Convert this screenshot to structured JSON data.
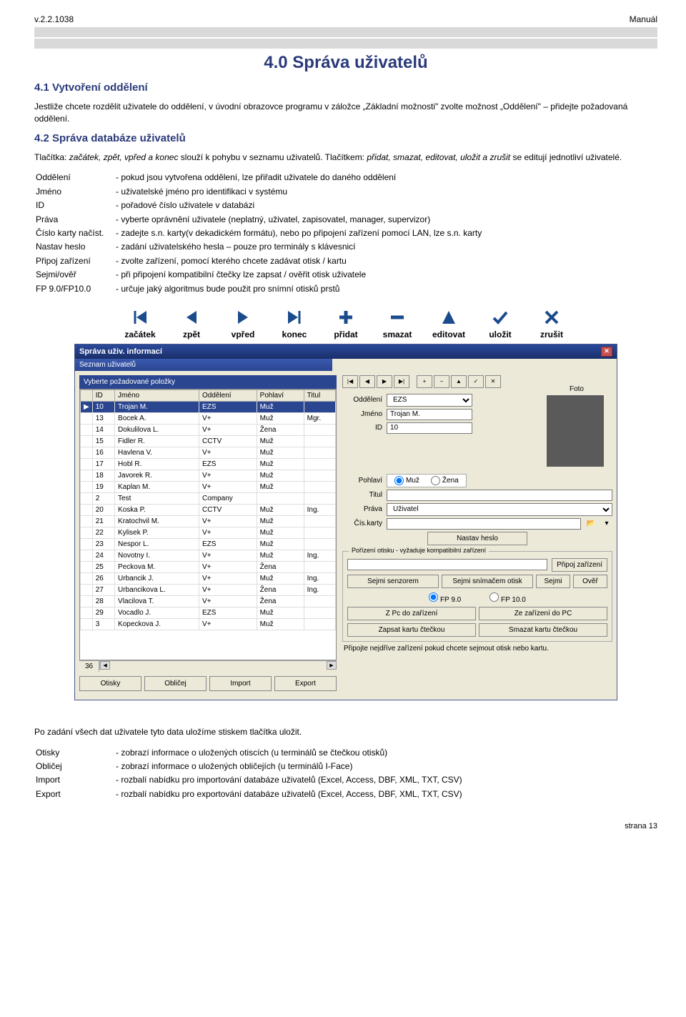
{
  "header": {
    "version": "v.2.2.1038",
    "doc_type": "Manuál"
  },
  "title": "4.0 Správa uživatelů",
  "section1": {
    "heading": "4.1 Vytvoření oddělení",
    "text": "Jestliže chcete rozdělit uživatele do oddělení, v úvodní obrazovce programu v záložce „Základní možnosti\" zvolte možnost „Oddělení\" – přidejte požadovaná oddělení."
  },
  "section2": {
    "heading": "4.2 Správa databáze uživatelů",
    "intro_a": "Tlačítka: ",
    "intro_b": "začátek, zpět, vpřed a konec",
    "intro_c": " slouží k pohybu v seznamu uživatelů. Tlačítkem: ",
    "intro_d": "přidat, smazat, editovat, uložit a zrušit",
    "intro_e": " se editují jednotliví uživatelé.",
    "defs": [
      {
        "k": "Oddělení",
        "v": "- pokud jsou vytvořena oddělení, lze přiřadit uživatele do daného oddělení"
      },
      {
        "k": "Jméno",
        "v": "- uživatelské jméno pro identifikaci v systému"
      },
      {
        "k": "ID",
        "v": "- pořadové číslo uživatele v databázi"
      },
      {
        "k": "Práva",
        "v": "- vyberte oprávnění uživatele (neplatný, uživatel, zapisovatel, manager, supervizor)"
      },
      {
        "k": "Číslo karty načíst.",
        "v": "- zadejte s.n. karty(v dekadickém formátu), nebo po připojení zařízení pomocí LAN, lze s.n. karty"
      },
      {
        "k": "Nastav heslo",
        "v": "- zadání uživatelského hesla – pouze pro terminály s klávesnicí"
      },
      {
        "k": "Připoj zařízení",
        "v": "- zvolte zařízení, pomocí kterého chcete zadávat otisk / kartu"
      },
      {
        "k": "Sejmi/ověř",
        "v": "- při připojení kompatibilní čtečky lze zapsat / ověřit otisk uživatele"
      },
      {
        "k": "FP 9.0/FP10.0",
        "v": "- určuje jaký algoritmus bude použit pro snímní otisků prstů"
      }
    ]
  },
  "toolbar": [
    "začátek",
    "zpět",
    "vpřed",
    "konec",
    "přidat",
    "smazat",
    "editovat",
    "uložit",
    "zrušit"
  ],
  "window": {
    "title": "Správa uživ. informací",
    "subtitle": "Seznam uživatelů",
    "prompt": "Vyberte požadované položky",
    "cols": [
      "ID",
      "Jméno",
      "Oddělení",
      "Pohlaví",
      "Titul"
    ],
    "rows": [
      {
        "id": "10",
        "n": "Trojan M.",
        "d": "EZS",
        "p": "Muž",
        "t": "",
        "sel": true,
        "mark": "▶"
      },
      {
        "id": "13",
        "n": "Bocek A.",
        "d": "V+",
        "p": "Muž",
        "t": "Mgr."
      },
      {
        "id": "14",
        "n": "Dokulilova L.",
        "d": "V+",
        "p": "Žena",
        "t": ""
      },
      {
        "id": "15",
        "n": "Fidler R.",
        "d": "CCTV",
        "p": "Muž",
        "t": ""
      },
      {
        "id": "16",
        "n": "Havlena V.",
        "d": "V+",
        "p": "Muž",
        "t": ""
      },
      {
        "id": "17",
        "n": "Hobl R.",
        "d": "EZS",
        "p": "Muž",
        "t": ""
      },
      {
        "id": "18",
        "n": "Javorek R.",
        "d": "V+",
        "p": "Muž",
        "t": ""
      },
      {
        "id": "19",
        "n": "Kaplan M.",
        "d": "V+",
        "p": "Muž",
        "t": ""
      },
      {
        "id": "2",
        "n": "Test",
        "d": "Company",
        "p": "",
        "t": ""
      },
      {
        "id": "20",
        "n": "Koska P.",
        "d": "CCTV",
        "p": "Muž",
        "t": "Ing."
      },
      {
        "id": "21",
        "n": "Kratochvil M.",
        "d": "V+",
        "p": "Muž",
        "t": ""
      },
      {
        "id": "22",
        "n": "Kylisek P.",
        "d": "V+",
        "p": "Muž",
        "t": ""
      },
      {
        "id": "23",
        "n": "Nespor L.",
        "d": "EZS",
        "p": "Muž",
        "t": ""
      },
      {
        "id": "24",
        "n": "Novotny I.",
        "d": "V+",
        "p": "Muž",
        "t": "Ing."
      },
      {
        "id": "25",
        "n": "Peckova M.",
        "d": "V+",
        "p": "Žena",
        "t": ""
      },
      {
        "id": "26",
        "n": "Urbancik J.",
        "d": "V+",
        "p": "Muž",
        "t": "Ing."
      },
      {
        "id": "27",
        "n": "Urbancikova L.",
        "d": "V+",
        "p": "Žena",
        "t": "Ing."
      },
      {
        "id": "28",
        "n": "Vlacilova T.",
        "d": "V+",
        "p": "Žena",
        "t": ""
      },
      {
        "id": "29",
        "n": "Vocadlo J.",
        "d": "EZS",
        "p": "Muž",
        "t": ""
      },
      {
        "id": "3",
        "n": "Kopeckova J.",
        "d": "V+",
        "p": "Muž",
        "t": ""
      }
    ],
    "count": "36",
    "buttons": [
      "Otisky",
      "Obličej",
      "Import",
      "Export"
    ],
    "form": {
      "foto": "Foto",
      "oddeleni_lbl": "Oddělení",
      "oddeleni": "EZS",
      "jmeno_lbl": "Jméno",
      "jmeno": "Trojan M.",
      "id_lbl": "ID",
      "id": "10",
      "pohlavi_lbl": "Pohlaví",
      "muz": "Muž",
      "zena": "Žena",
      "titul_lbl": "Titul",
      "titul": "",
      "prava_lbl": "Práva",
      "prava": "Uživatel",
      "karta_lbl": "Čís.karty",
      "karta": "",
      "heslo_btn": "Nastav heslo",
      "fs_legend": "Pořízení otisku - vyžaduje kompatibilní zařízení",
      "pripoj": "Připoj zařízení",
      "sejmi_senz": "Sejmi senzorem",
      "sejmi_snim": "Sejmi snímačem otisk",
      "sejmi": "Sejmi",
      "over": "Ověř",
      "fp90": "FP 9.0",
      "fp100": "FP 10.0",
      "zpc": "Z Pc do zařízení",
      "zezar": "Ze zařízení do PC",
      "zapsat": "Zapsat kartu čtečkou",
      "smazat": "Smazat kartu čtečkou",
      "note": "Připojte nejdříve zařízení pokud chcete sejmout otisk nebo kartu."
    }
  },
  "post": "Po zadání všech dat uživatele tyto data uložíme stiskem tlačítka uložit.",
  "defs2": [
    {
      "k": "Otisky",
      "v": "- zobrazí informace o uložených otiscích (u terminálů se čtečkou otisků)"
    },
    {
      "k": "Obličej",
      "v": "- zobrazí informace o uložených obličejích (u terminálů I-Face)"
    },
    {
      "k": "Import",
      "v": "- rozbalí nabídku pro importování databáze uživatelů (Excel, Access, DBF, XML, TXT, CSV)"
    },
    {
      "k": "Export",
      "v": "- rozbalí nabídku pro exportování databáze uživatelů (Excel, Access, DBF, XML, TXT, CSV)"
    }
  ],
  "footer": "strana 13"
}
